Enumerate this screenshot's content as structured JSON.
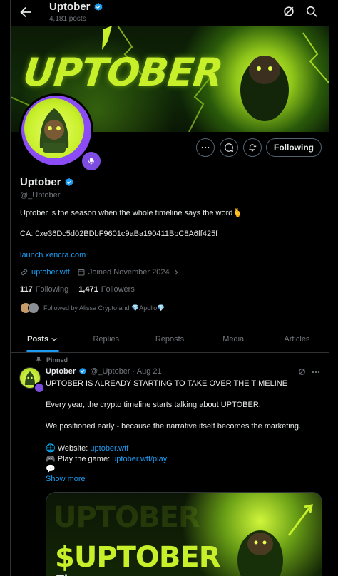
{
  "header": {
    "title": "Uptober",
    "post_count": "4,181 posts"
  },
  "banner": {
    "text": "UPTOBER"
  },
  "actions": {
    "following_label": "Following"
  },
  "profile": {
    "name": "Uptober",
    "handle": "@_Uptober",
    "bio": "Uptober is the season when the whole timeline says the word",
    "bio_emoji": "🫰",
    "ca": "CA: 0xe36Dc5d02BDbF9601c9aBa190411BbC8A6ff425f",
    "bio_link": "launch.xencra.com",
    "website": "uptober.wtf",
    "joined": "Joined November 2024",
    "following_count": "117",
    "following_label": "Following",
    "followers_count": "1,471",
    "followers_label": "Followers",
    "followed_by": "Followed by Alissa Crypto and 💎Apollo💎"
  },
  "tabs": [
    {
      "label": "Posts"
    },
    {
      "label": "Replies"
    },
    {
      "label": "Reposts"
    },
    {
      "label": "Media"
    },
    {
      "label": "Articles"
    }
  ],
  "post": {
    "pinned_label": "Pinned",
    "author": "Uptober",
    "meta": "@_Uptober · Aug 21",
    "line1": "UPTOBER IS ALREADY STARTING TO TAKE OVER THE TIMELINE",
    "line2": "Every year, the crypto timeline starts talking about UPTOBER.",
    "line3": "We positioned early - because the narrative itself becomes the marketing.",
    "website_label": "🌐 Website: ",
    "website_link": "uptober.wtf",
    "game_label": "🎮 Play the game: ",
    "game_link": "uptober.wtf/play",
    "chat_emoji": "💬",
    "show_more": "Show more",
    "media_ghost": "UPTOBER",
    "media_title": "$UPTOBER",
    "media_sub": "Th"
  },
  "colors": {
    "accent": "#1d9bf0",
    "verified": "#1d9bf0",
    "ring": "#8b4cf6",
    "brand_green": "#c7f02a"
  }
}
